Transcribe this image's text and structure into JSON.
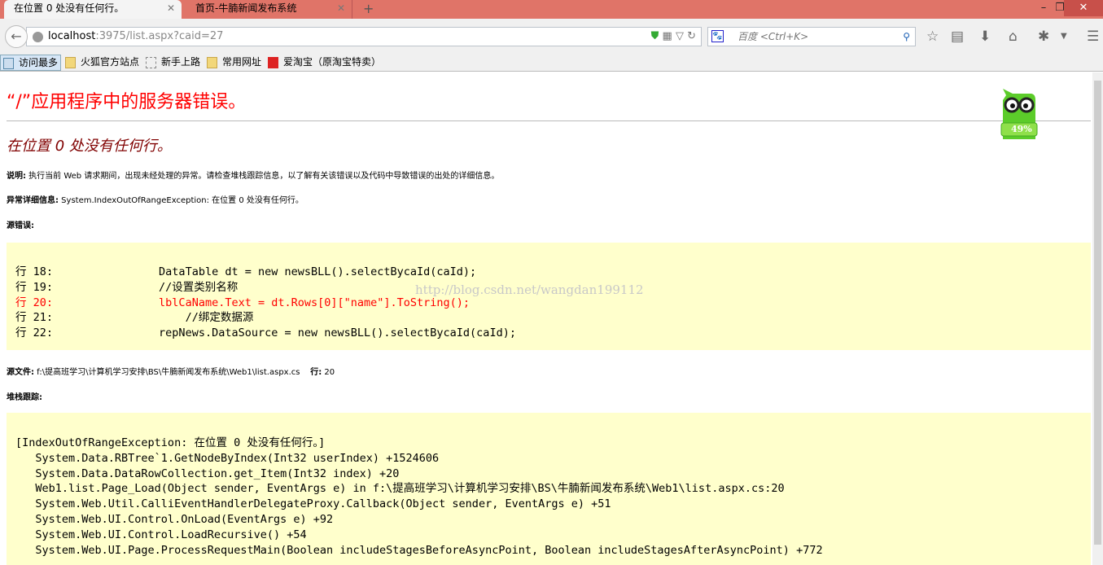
{
  "browser": {
    "tabs": [
      {
        "label": "在位置 0 处没有任何行。",
        "active": true
      },
      {
        "label": "首页-牛腩新闻发布系统",
        "active": false
      }
    ],
    "url_host": "localhost",
    "url_rest": ":3975/list.aspx?caid=27",
    "search_placeholder": "百度 <Ctrl+K>",
    "bookmarks": [
      {
        "label": "访问最多",
        "icon": "search-page-icon"
      },
      {
        "label": "火狐官方站点",
        "icon": "folder-icon"
      },
      {
        "label": "新手上路",
        "icon": "dashed-page-icon"
      },
      {
        "label": "常用网址",
        "icon": "folder-icon"
      },
      {
        "label": "爱淘宝（原淘宝特卖）",
        "icon": "taobao-icon"
      }
    ]
  },
  "page": {
    "title": "“/”应用程序中的服务器错误。",
    "subtitle": "在位置 0 处没有任何行。",
    "desc_label": "说明:",
    "desc_text": " 执行当前 Web 请求期间，出现未经处理的异常。请检查堆栈跟踪信息，以了解有关该错误以及代码中导致错误的出处的详细信息。",
    "exc_label": "异常详细信息:",
    "exc_text": " System.IndexOutOfRangeException: 在位置 0 处没有任何行。",
    "src_err_label": "源错误:",
    "source_lines": [
      {
        "text": "行 18:                DataTable dt = new newsBLL().selectBycaId(caId);",
        "error": false
      },
      {
        "text": "行 19:                //设置类别名称",
        "error": false
      },
      {
        "text": "行 20:                lblCaName.Text = dt.Rows[0][\"name\"].ToString();",
        "error": true
      },
      {
        "text": "行 21:                    //绑定数据源",
        "error": false
      },
      {
        "text": "行 22:                repNews.DataSource = new newsBLL().selectBycaId(caId);",
        "error": false
      }
    ],
    "src_file_label": "源文件:",
    "src_file": " f:\\提高班学习\\计算机学习安排\\BS\\牛腩新闻发布系统\\Web1\\list.aspx.cs",
    "line_label": "行:",
    "line_num": " 20",
    "stack_label": "堆栈跟踪:",
    "stack_lines": [
      "[IndexOutOfRangeException: 在位置 0 处没有任何行。]",
      "   System.Data.RBTree`1.GetNodeByIndex(Int32 userIndex) +1524606",
      "   System.Data.DataRowCollection.get_Item(Int32 index) +20",
      "   Web1.list.Page_Load(Object sender, EventArgs e) in f:\\提高班学习\\计算机学习安排\\BS\\牛腩新闻发布系统\\Web1\\list.aspx.cs:20",
      "   System.Web.Util.CalliEventHandlerDelegateProxy.Callback(Object sender, EventArgs e) +51",
      "   System.Web.UI.Control.OnLoad(EventArgs e) +92",
      "   System.Web.UI.Control.LoadRecursive() +54",
      "   System.Web.UI.Page.ProcessRequestMain(Boolean includeStagesBeforeAsyncPoint, Boolean includeStagesAfterAsyncPoint) +772"
    ],
    "watermark": "http://blog.csdn.net/wangdan199112",
    "mascot_percent": "49%"
  }
}
